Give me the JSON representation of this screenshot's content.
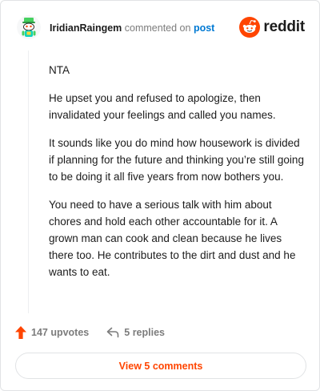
{
  "header": {
    "username": "IridianRaingem",
    "commented_on": "commented on",
    "post_link": "post",
    "brand": "reddit"
  },
  "colors": {
    "brand_orange": "#ff4500",
    "link_blue": "#0079d3",
    "text_dark": "#1c1c1c",
    "text_muted": "#7c7c7c"
  },
  "icons": {
    "avatar": "snoo-avatar-icon",
    "brand": "reddit-logo-icon",
    "upvote": "upvote-arrow-icon",
    "reply": "reply-arrow-icon"
  },
  "comment": {
    "paragraphs": [
      "NTA",
      "He upset you and refused to apologize, then invalidated your feelings and called you names.",
      "It sounds like you do mind how housework is divided if planning for the future and thinking you’re still going to be doing it all five years from now bothers you.",
      "You need to have a serious talk with him about chores and hold each other accountable for it. A grown man can cook and clean because he lives there too. He contributes to the dirt and dust and he wants to eat."
    ]
  },
  "actions": {
    "upvotes": "147 upvotes",
    "replies": "5 replies"
  },
  "footer": {
    "view_comments": "View 5 comments"
  }
}
